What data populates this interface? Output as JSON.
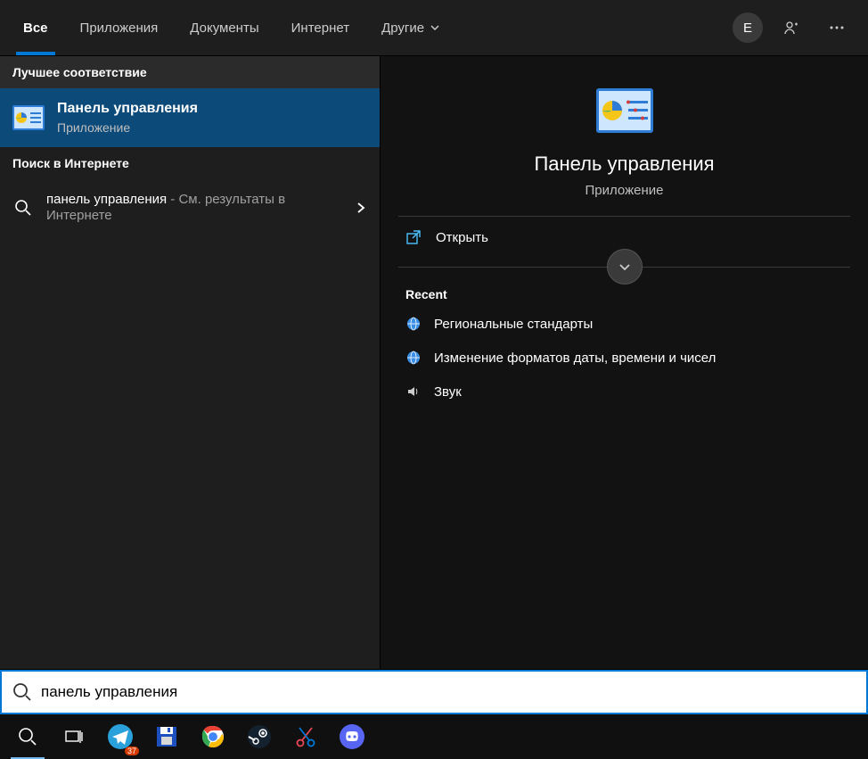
{
  "tabs": {
    "all": "Все",
    "apps": "Приложения",
    "documents": "Документы",
    "internet": "Интернет",
    "other": "Другие"
  },
  "user_initial": "E",
  "sections": {
    "best_match": "Лучшее соответствие",
    "web_search": "Поиск в Интернете"
  },
  "best_result": {
    "title": "Панель управления",
    "subtitle": "Приложение"
  },
  "web_result": {
    "query": "панель управления",
    "suffix": " - См. результаты в Интернете"
  },
  "preview": {
    "title": "Панель управления",
    "subtitle": "Приложение",
    "open_label": "Открыть",
    "recent_header": "Recent",
    "recent": [
      "Региональные стандарты",
      "Изменение форматов даты, времени и чисел",
      "Звук"
    ]
  },
  "search": {
    "value": "панель управления"
  },
  "taskbar": {
    "telegram_badge": "37"
  }
}
